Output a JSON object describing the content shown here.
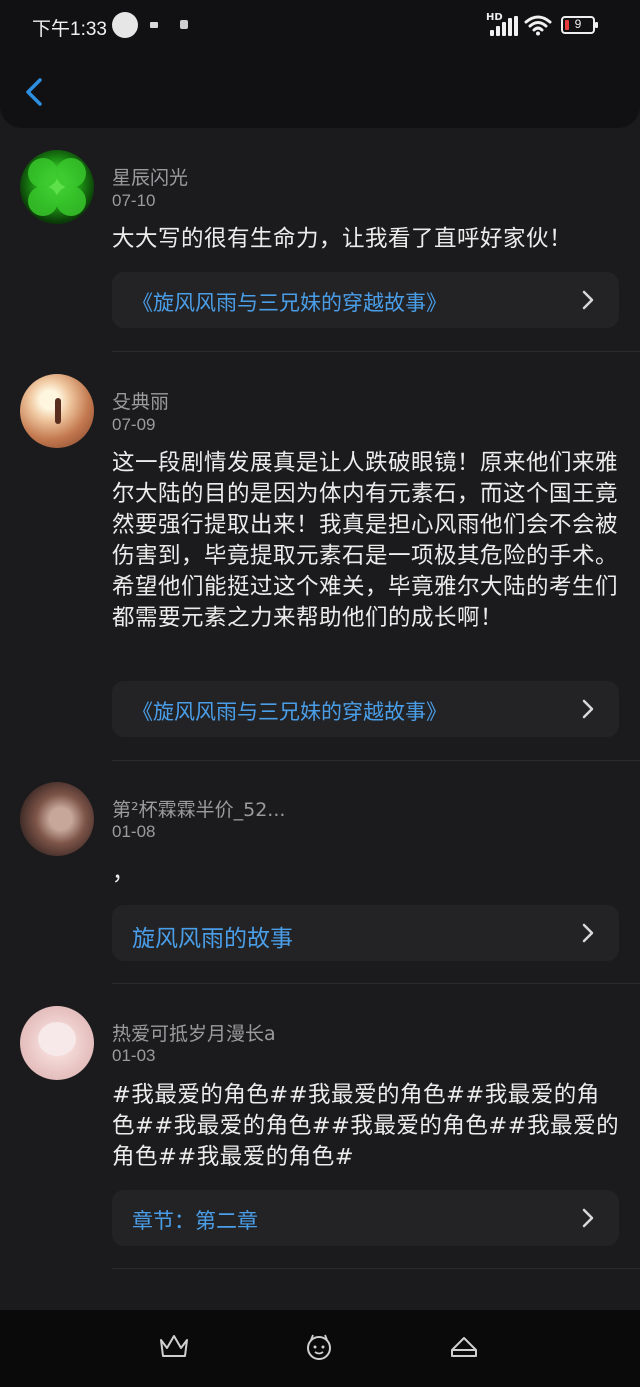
{
  "status_bar": {
    "time": "下午1:33",
    "network_label": "HD",
    "battery_level": "9",
    "icons": [
      "cloud-notification-icon",
      "message-icon",
      "app-notification-icon",
      "signal-icon",
      "wifi-icon",
      "battery-icon"
    ]
  },
  "nav": {
    "back_icon": "chevron-left-icon"
  },
  "comments": [
    {
      "username": "星辰闪光",
      "date": "07-10",
      "text": "大大写的很有生命力，让我看了直呼好家伙！",
      "link": "《旋风风雨与三兄妹的穿越故事》"
    },
    {
      "username": "殳典丽",
      "date": "07-09",
      "text": "这一段剧情发展真是让人跌破眼镜！原来他们来雅尔大陆的目的是因为体内有元素石，而这个国王竟然要强行提取出来！我真是担心风雨他们会不会被伤害到，毕竟提取元素石是一项极其危险的手术。希望他们能挺过这个难关，毕竟雅尔大陆的考生们都需要元素之力来帮助他们的成长啊！",
      "link": "《旋风风雨与三兄妹的穿越故事》"
    },
    {
      "username": "第²杯霖霖半价_52...",
      "date": "01-08",
      "text": "，",
      "link": "旋风风雨的故事"
    },
    {
      "username": "热爱可抵岁月漫长a",
      "date": "01-03",
      "text": "#我最爱的角色##我最爱的角色##我最爱的角色##我最爱的角色##我最爱的角色##我最爱的角色##我最爱的角色#",
      "link": "章节：第二章"
    }
  ],
  "bottom_nav": {
    "items": [
      "crown-icon",
      "face-icon",
      "cake-icon"
    ]
  },
  "colors": {
    "background": "#1b1b1d",
    "link": "#4a9ee8",
    "accent": "#2d8fe0",
    "muted_text": "#9b9b9e"
  }
}
